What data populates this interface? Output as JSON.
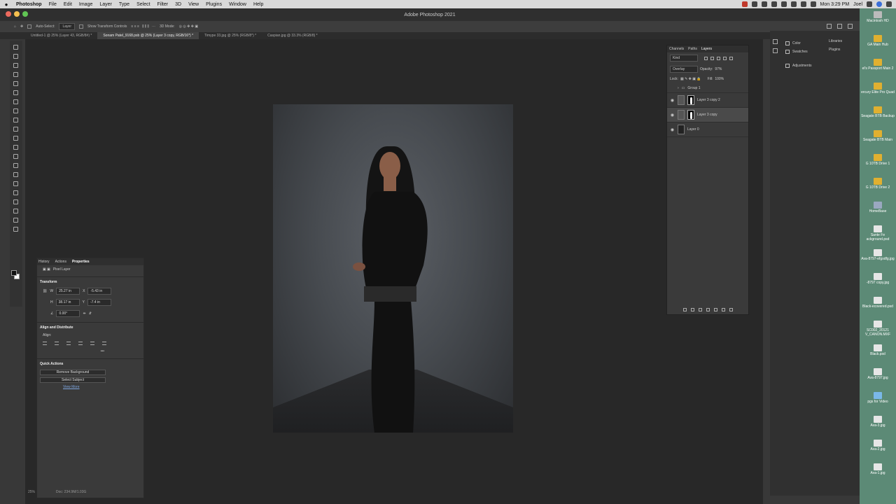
{
  "menubar": {
    "apple": "",
    "app_name": "Photoshop",
    "items": [
      "File",
      "Edit",
      "Image",
      "Layer",
      "Type",
      "Select",
      "Filter",
      "3D",
      "View",
      "Plugins",
      "Window",
      "Help"
    ],
    "clock": "Mon 3:29 PM",
    "user": "Joel"
  },
  "window": {
    "title": "Adobe Photoshop 2021"
  },
  "options_bar": {
    "auto_select_label": "Auto-Select:",
    "auto_select_value": "Layer",
    "show_transform_label": "Show Transform Controls",
    "mode_label": "3D Mode:"
  },
  "doc_tabs": [
    {
      "label": "Untitled-1 @ 25% (Layer 43, RGB/8#) *"
    },
    {
      "label": "Sonam Patel_9168.psb @ 25% (Layer 3 copy, RGB/16*) *"
    },
    {
      "label": "Timype 33.jpg @ 25% (RGB/8*) *"
    },
    {
      "label": "Caspian.jpg @ 33.3% (RGB/8) *"
    }
  ],
  "properties": {
    "tabs": [
      "History",
      "Actions",
      "Properties"
    ],
    "layer_type": "Pixel Layer",
    "transform_title": "Transform",
    "w_label": "W",
    "w_value": "25.27 in",
    "h_label": "H",
    "h_value": "38.17 in",
    "x_label": "X",
    "x_value": "-5.43 in",
    "y_label": "Y",
    "y_value": "-7.4 in",
    "angle_value": "0.00°",
    "align_title": "Align and Distribute",
    "align_label": "Align:",
    "more": "•••",
    "quick_actions_title": "Quick Actions",
    "remove_bg": "Remove Background",
    "select_subject": "Select Subject",
    "view_more": "View More"
  },
  "layers": {
    "tabs": [
      "Channels",
      "Paths",
      "Layers"
    ],
    "filter_kind": "Kind",
    "blend_mode": "Overlay",
    "opacity_label": "Opacity:",
    "opacity_value": "97%",
    "lock_label": "Lock:",
    "fill_label": "Fill:",
    "fill_value": "100%",
    "rows": [
      {
        "name": "Group 1",
        "type": "group"
      },
      {
        "name": "Layer 3 copy 2",
        "type": "masked"
      },
      {
        "name": "Layer 3 copy",
        "type": "masked",
        "selected": true
      },
      {
        "name": "Layer 0",
        "type": "pixel"
      }
    ]
  },
  "right_dock": {
    "group1": [
      "Color",
      "Swatches"
    ],
    "group2": [
      "Adjustments"
    ],
    "group3": [
      "Libraries",
      "Plugins"
    ]
  },
  "status": {
    "zoom": "25%",
    "doc_size": "Doc: 234.9M/1.03G"
  },
  "desktop": [
    {
      "label": "Macintosh HD",
      "color": "#bbbbbb"
    },
    {
      "label": "GA Main Hub",
      "color": "#e0b030"
    },
    {
      "label": "el's Passport Main 2",
      "color": "#e0b030"
    },
    {
      "label": "ercury Elite Pro Quad",
      "color": "#e0b030"
    },
    {
      "label": "Seagate BTB Backup",
      "color": "#e0b030"
    },
    {
      "label": "Seagate BTB Main",
      "color": "#e0b030"
    },
    {
      "label": "G 10TB Drive 1",
      "color": "#e0b030"
    },
    {
      "label": "G 10TB Drive 2",
      "color": "#e0b030"
    },
    {
      "label": "HomeBase",
      "color": "#9aa8c0"
    },
    {
      "label": "Sante Fe ackground.psd",
      "color": "#e6e6e6"
    },
    {
      "label": "Ava-8797-efgsdfg.jpg",
      "color": "#e6e6e6"
    },
    {
      "label": "-8797 copy.jpg",
      "color": "#e6e6e6"
    },
    {
      "label": "Black-ecovered.psd",
      "color": "#e6e6e6"
    },
    {
      "label": "SC002_20121 V_CANON.MXF",
      "color": "#e6e6e6"
    },
    {
      "label": "Black.psd",
      "color": "#e6e6e6"
    },
    {
      "label": "Ava-8797.jpg",
      "color": "#e6e6e6"
    },
    {
      "label": "pgs for Video",
      "color": "#7ab8e8"
    },
    {
      "label": "Ava-3.jpg",
      "color": "#e6e6e6"
    },
    {
      "label": "Ava-2.jpg",
      "color": "#e6e6e6"
    },
    {
      "label": "Ava-1.jpg",
      "color": "#e6e6e6"
    }
  ]
}
